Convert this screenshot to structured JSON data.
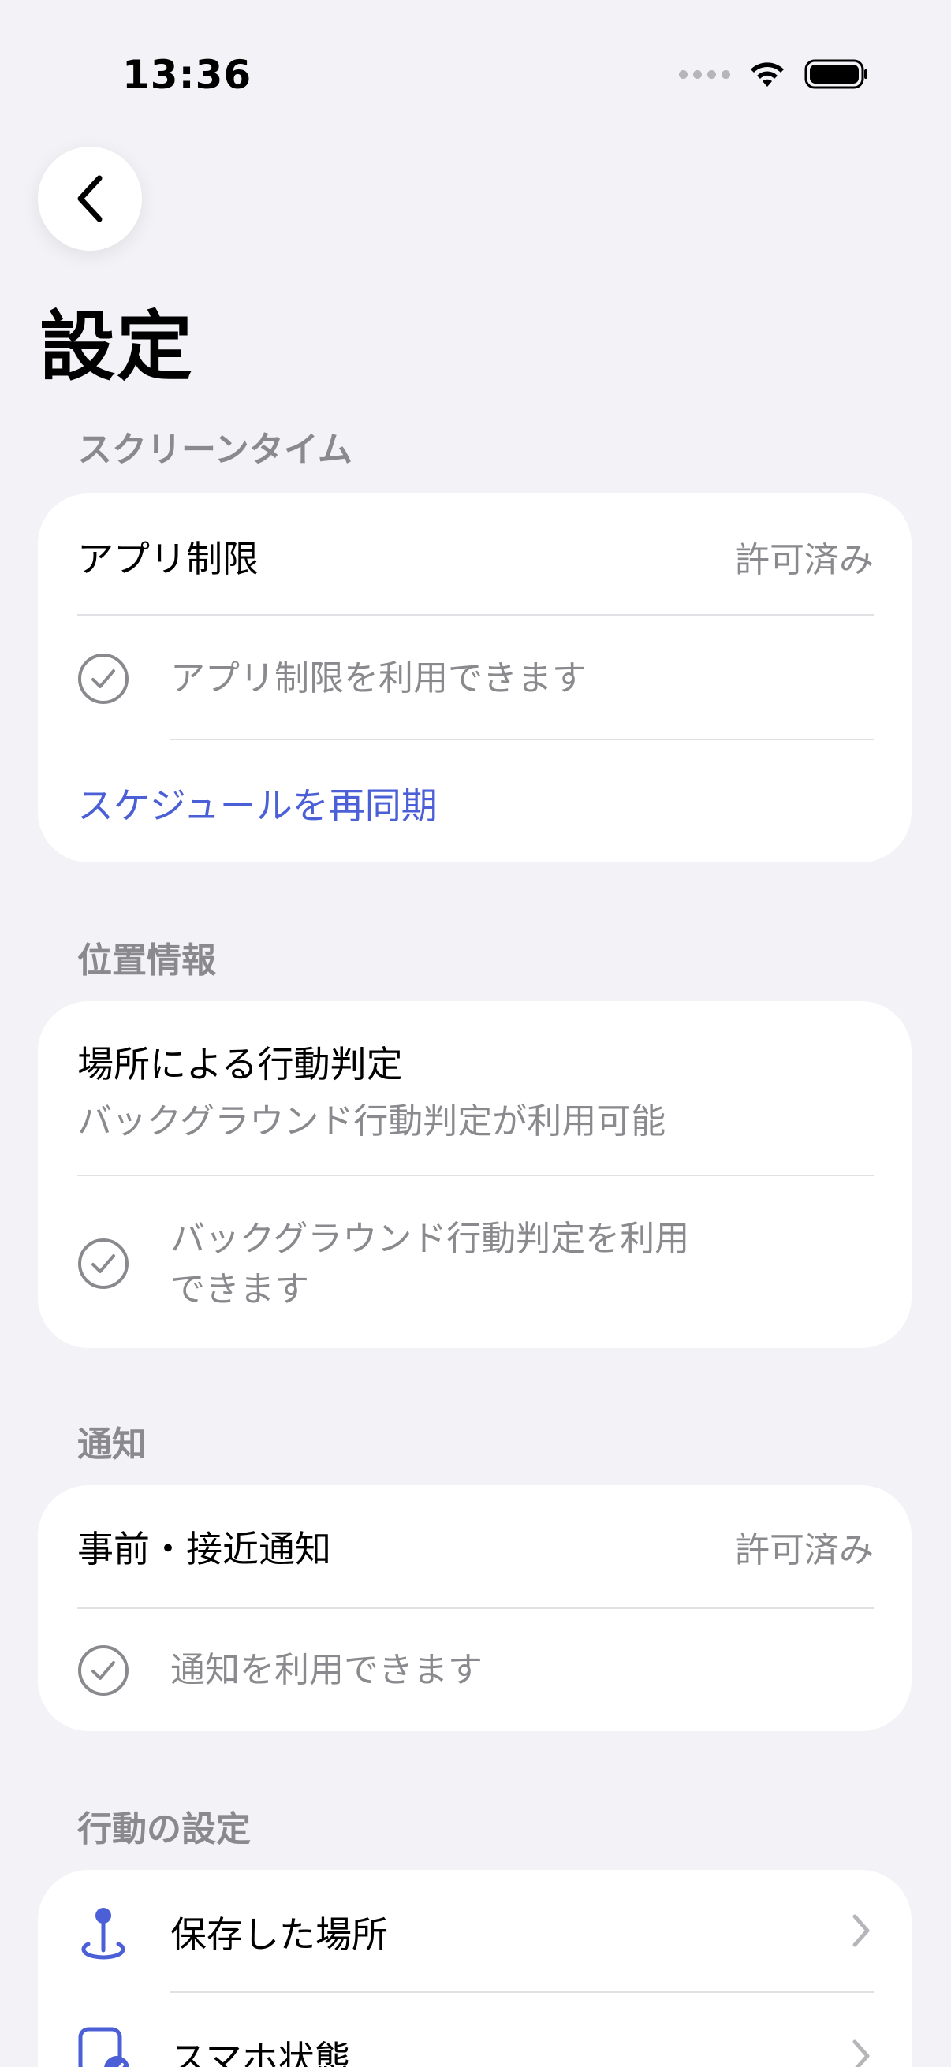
{
  "status_bar": {
    "time": "13:36"
  },
  "page": {
    "title": "設定"
  },
  "sections": {
    "screen_time": {
      "header": "スクリーンタイム",
      "app_limit_label": "アプリ制限",
      "app_limit_value": "許可済み",
      "status_text": "アプリ制限を利用できます",
      "resync_label": "スケジュールを再同期"
    },
    "location": {
      "header": "位置情報",
      "title": "場所による行動判定",
      "subtitle": "バックグラウンド行動判定が利用可能",
      "status_line1": "バックグラウンド行動判定を利用",
      "status_line2": "できます"
    },
    "notifications": {
      "header": "通知",
      "label": "事前・接近通知",
      "value": "許可済み",
      "status_text": "通知を利用できます"
    },
    "behavior": {
      "header": "行動の設定",
      "items": [
        {
          "label": "保存した場所",
          "icon": "location-pin-icon"
        },
        {
          "label": "スマホ状態",
          "icon": "phone-state-icon"
        }
      ]
    }
  },
  "colors": {
    "background": "#f2f2f7",
    "card": "#ffffff",
    "secondary_text": "#8a8a8e",
    "accent": "#4b5fd6"
  }
}
